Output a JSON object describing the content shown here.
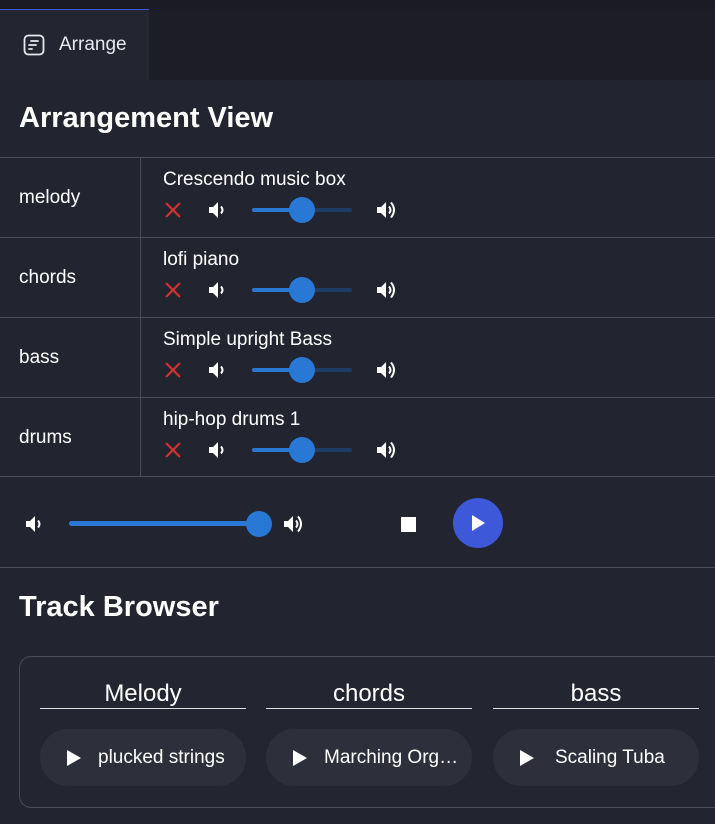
{
  "tabs": [
    {
      "label": "Arrange",
      "icon": "arrange-icon"
    }
  ],
  "arrangement": {
    "title": "Arrangement View",
    "rows": [
      {
        "part": "melody",
        "instrument": "Crescendo music box",
        "volume": 0.5
      },
      {
        "part": "chords",
        "instrument": "lofi piano",
        "volume": 0.5
      },
      {
        "part": "bass",
        "instrument": "Simple upright Bass",
        "volume": 0.5
      },
      {
        "part": "drums",
        "instrument": "hip-hop drums 1",
        "volume": 0.5
      }
    ]
  },
  "transport": {
    "master_volume": 1.0
  },
  "browser": {
    "title": "Track Browser",
    "columns": [
      {
        "heading": "Melody",
        "track": "plucked strings"
      },
      {
        "heading": "chords",
        "track": "Marching Org…"
      },
      {
        "heading": "bass",
        "track": "Scaling Tuba"
      }
    ]
  },
  "colors": {
    "accent": "#2a78d6",
    "play": "#3d59d9",
    "remove": "#d0332f",
    "background": "#222430"
  }
}
